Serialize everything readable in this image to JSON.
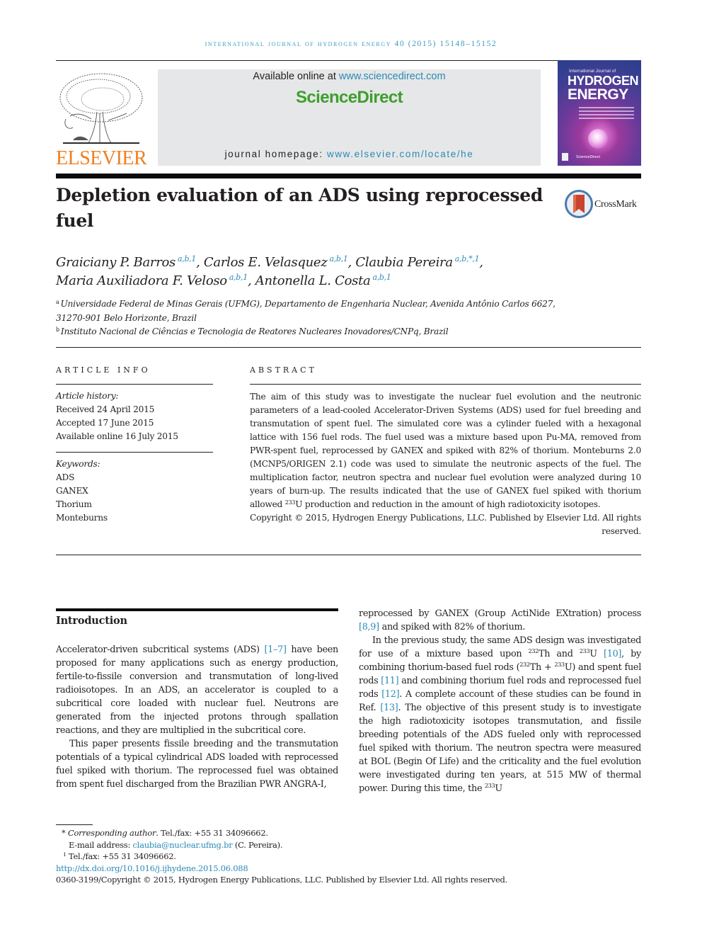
{
  "header": {
    "running_head": "INTERNATIONAL JOURNAL OF HYDROGEN ENERGY 40 (2015) 15148–15152",
    "publisher_logo_text": "ELSEVIER",
    "sciencedirect": {
      "available_prefix": "Available online at ",
      "available_link": "www.sciencedirect.com",
      "brand": "ScienceDirect",
      "homepage_prefix": "journal homepage: ",
      "homepage_link": "www.elsevier.com/locate/he"
    },
    "cover": {
      "small_line": "International Journal of",
      "title_line1": "HYDROGEN",
      "title_line2": "ENERGY",
      "footer_text": "ScienceDirect"
    }
  },
  "article": {
    "title": "Depletion evaluation of an ADS using reprocessed fuel",
    "crossmark_label": "CrossMark",
    "authors": [
      {
        "name": "Graiciany P. Barros",
        "sup": "a,b,1",
        "sep": ", "
      },
      {
        "name": "Carlos E. Velasquez",
        "sup": "a,b,1",
        "sep": ", "
      },
      {
        "name": "Claubia Pereira",
        "sup": "a,b,*,1",
        "sep": ","
      },
      {
        "name": "Maria Auxiliadora F. Veloso",
        "sup": "a,b,1",
        "sep": ", "
      },
      {
        "name": "Antonella L. Costa",
        "sup": "a,b,1",
        "sep": ""
      }
    ],
    "affiliations": [
      {
        "mark": "a",
        "text": "Universidade Federal de Minas Gerais (UFMG), Departamento de Engenharia Nuclear, Avenida Antônio Carlos 6627, 31270-901 Belo Horizonte, Brazil"
      },
      {
        "mark": "b",
        "text": "Instituto Nacional de Ciências e Tecnologia de Reatores Nucleares Inovadores/CNPq, Brazil"
      }
    ]
  },
  "article_info": {
    "heading": "ARTICLE INFO",
    "history_label": "Article history:",
    "history": [
      "Received 24 April 2015",
      "Accepted 17 June 2015",
      "Available online 16 July 2015"
    ],
    "keywords_label": "Keywords:",
    "keywords": [
      "ADS",
      "GANEX",
      "Thorium",
      "Monteburns"
    ]
  },
  "abstract": {
    "heading": "ABSTRACT",
    "text_before_sup": "The aim of this study was to investigate the nuclear fuel evolution and the neutronic parameters of a lead-cooled Accelerator-Driven Systems (ADS) used for fuel breeding and transmutation of spent fuel. The simulated core was a cylinder fueled with a hexagonal lattice with 156 fuel rods. The fuel used was a mixture based upon Pu-MA, removed from PWR-spent fuel, reprocessed by GANEX and spiked with 82% of thorium. Monteburns 2.0 (MCNP5/ORIGEN 2.1) code was used to simulate the neutronic aspects of the fuel. The multiplication factor, neutron spectra and nuclear fuel evolution were analyzed during 10 years of burn-up. The results indicated that the use of GANEX fuel spiked with thorium allowed ",
    "sup": "233",
    "text_after_sup": "U production and reduction in the amount of high radiotoxicity isotopes.",
    "copyright": "Copyright © 2015, Hydrogen Energy Publications, LLC. Published by Elsevier Ltd. All rights reserved."
  },
  "introduction": {
    "heading": "Introduction",
    "left": {
      "p1_a": "Accelerator-driven subcritical systems (ADS) ",
      "p1_ref": "[1–7]",
      "p1_b": " have been proposed for many applications such as energy production, fertile-to-fissile conversion and transmutation of long-lived radioisotopes. In an ADS, an accelerator is coupled to a subcritical core loaded with nuclear fuel. Neutrons are generated from the injected protons through spallation reactions, and they are multiplied in the subcritical core.",
      "p2": "This paper presents fissile breeding and the transmutation potentials of a typical cylindrical ADS loaded with reprocessed fuel spiked with thorium. The reprocessed fuel was obtained from spent fuel discharged from the Brazilian PWR ANGRA-I,"
    },
    "right": {
      "p1_a": "reprocessed by GANEX (Group ActiNide EXtration) process ",
      "p1_ref": "[8,9]",
      "p1_b": " and spiked with 82% of thorium.",
      "p2_a": "In the previous study, the same ADS design was investigated for use of a mixture based upon ",
      "sup_232": "232",
      "p2_b": "Th and ",
      "sup_233": "233",
      "p2_c": "U ",
      "ref10": "[10]",
      "p2_d": ", by combining thorium-based fuel rods (",
      "p2_e": "Th + ",
      "p2_f": "U) and spent fuel rods ",
      "ref11": "[11]",
      "p2_g": " and combining thorium fuel rods and reprocessed fuel rods ",
      "ref12": "[12]",
      "p2_h": ". A complete account of these studies can be found in Ref. ",
      "ref13": "[13]",
      "p2_i": ". The objective of this present study is to investigate the high radiotoxicity isotopes transmutation, and fissile breeding potentials of the ADS fueled only with reprocessed fuel spiked with thorium. The neutron spectra were measured at BOL (Begin Of Life) and the criticality and the fuel evolution were investigated during ten years, at 515 MW of thermal power. During this time, the ",
      "p2_j": "U"
    }
  },
  "footnotes": {
    "star_mark": "*",
    "corr_label": "Corresponding author",
    "corr_text": ". Tel./fax: +55 31 34096662.",
    "email_label": "E-mail address: ",
    "email": "claubia@nuclear.ufmg.br",
    "email_suffix": " (C. Pereira).",
    "one_mark": "1",
    "one_text": " Tel./fax: +55 31 34096662.",
    "doi": "http://dx.doi.org/10.1016/j.ijhydene.2015.06.088",
    "issn_copyright": "0360-3199/Copyright © 2015, Hydrogen Energy Publications, LLC. Published by Elsevier Ltd. All rights reserved."
  },
  "colors": {
    "link": "#2a8ab5",
    "running_head": "#3a9cc2",
    "sciencedirect_green": "#3e9f2e",
    "elsevier_orange": "#f07f21",
    "banner_gray": "#e6e7e8"
  }
}
